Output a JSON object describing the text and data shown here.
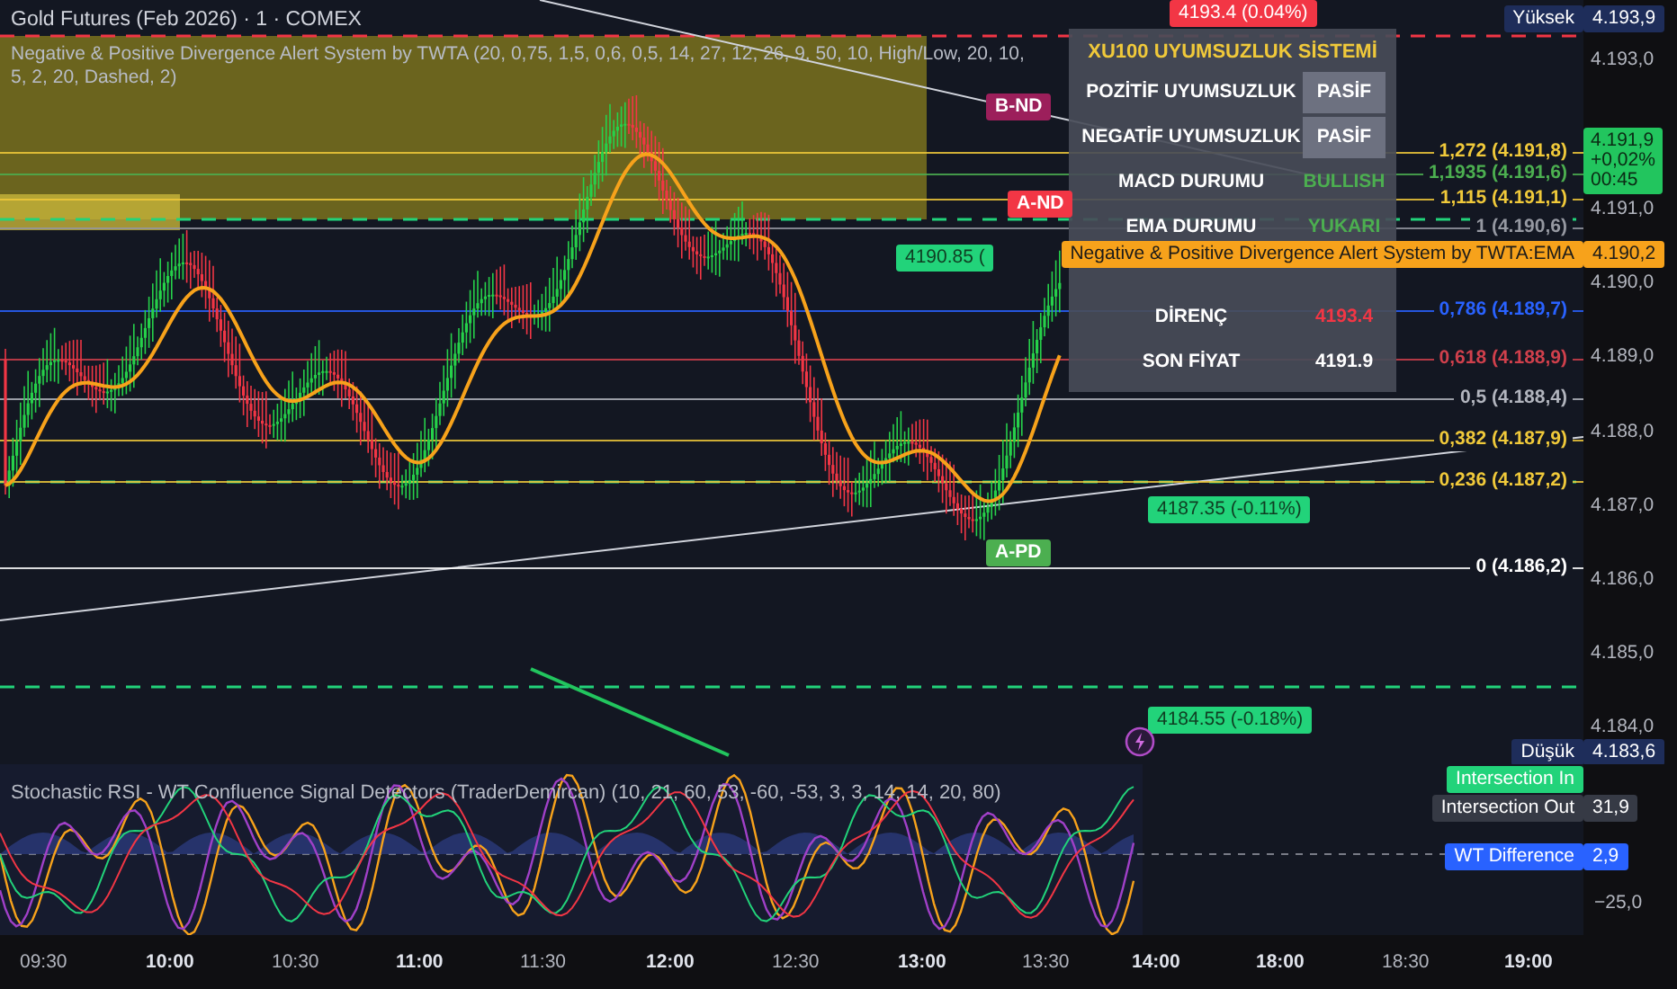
{
  "legend": {
    "symbol": "Gold Futures (Feb 2026) · 1 · COMEX",
    "indicator": "Negative & Positive Divergence Alert System by TWTA (20, 0,75, 1,5, 0,6, 0,5, 14, 27, 12, 26, 9, 50, 10, High/Low, 20, 10, 5, 2, 20, Dashed, 2)"
  },
  "table": {
    "title": "XU100 UYUMSUZLUK SİSTEMİ",
    "rows": [
      {
        "label": "POZİTİF UYUMSUZLUK",
        "value": "PASİF",
        "kind": "badge"
      },
      {
        "label": "NEGATİF UYUMSUZLUK",
        "value": "PASİF",
        "kind": "badge"
      },
      {
        "label": "MACD DURUMU",
        "value": "BULLISH",
        "kind": "text",
        "color": "#4caf50"
      },
      {
        "label": "EMA DURUMU",
        "value": "YUKARI",
        "kind": "text",
        "color": "#4caf50"
      },
      {
        "label": "DİRENÇ",
        "value": "4193.4",
        "kind": "text",
        "color": "#f23645"
      },
      {
        "label": "SON FİYAT",
        "value": "4191.9",
        "kind": "text",
        "color": "#ffffff"
      }
    ]
  },
  "fib_levels": [
    {
      "label": "1,272 (4.191,8)",
      "color": "#f0c93a"
    },
    {
      "label": "1,1935 (4.191,6)",
      "color": "#4caf50"
    },
    {
      "label": "1,115 (4.191,1)",
      "color": "#f0c93a"
    },
    {
      "label": "1 (4.190,6)",
      "color": "#9598a1"
    },
    {
      "label": "0,786 (4.189,7)",
      "color": "#2962ff"
    },
    {
      "label": "0,618 (4.188,9)",
      "color": "#d0404c"
    },
    {
      "label": "0,5 (4.188,4)",
      "color": "#b2b5be"
    },
    {
      "label": "0,382 (4.187,9)",
      "color": "#f0c93a"
    },
    {
      "label": "0,236 (4.187,2)",
      "color": "#f0c93a"
    },
    {
      "label": "0 (4.186,2)",
      "color": "#ffffff"
    }
  ],
  "chart_tags": [
    {
      "kind": "price",
      "text": "4193.4 (0.04%)",
      "color": "#f23645"
    },
    {
      "kind": "signal",
      "text": "B-ND",
      "color": "#9c1f5b"
    },
    {
      "kind": "signal",
      "text": "A-ND",
      "color": "#f23645"
    },
    {
      "kind": "price",
      "text": "4190.85 (",
      "color": "#22d37a"
    },
    {
      "kind": "signal",
      "text": "A-PD",
      "color": "#4caf50"
    },
    {
      "kind": "price",
      "text": "4187.35 (-0.11%)",
      "color": "#22d37a"
    },
    {
      "kind": "price",
      "text": "4184.55 (-0.18%)",
      "color": "#22d37a"
    }
  ],
  "price_axis": {
    "ticks": [
      "4.193,0",
      "4.191,0",
      "4.190,0",
      "4.189,0",
      "4.188,0",
      "4.187,0",
      "4.186,0",
      "4.185,0",
      "4.184,0"
    ],
    "high": {
      "label": "Yüksek",
      "value": "4.193,9"
    },
    "low": {
      "label": "Düşük",
      "value": "4.183,6"
    },
    "last": {
      "price": "4.191,9",
      "change": "+0,02%",
      "countdown": "00:45"
    },
    "ema_tag": {
      "name": "Negative & Positive Divergence Alert System by TWTA:EMA",
      "value": "4.190,2"
    }
  },
  "oscillator": {
    "legend": "Stochastic RSI - WT Confluence Signal Detectors (TraderDemircan) (10, 21, 60, 53, -60, -53, 3, 3, 14, 14, 20, 80)",
    "tags": [
      {
        "label": "Intersection In",
        "color": "#22d37a"
      },
      {
        "label": "Intersection Out",
        "value": "31,9",
        "color": "#363a45"
      },
      {
        "label": "WT Difference",
        "value": "2,9",
        "color": "#2962ff"
      }
    ],
    "ticks": [
      "−25,0"
    ]
  },
  "time_axis": [
    {
      "label": "09:30",
      "bold": false
    },
    {
      "label": "10:00",
      "bold": true
    },
    {
      "label": "10:30",
      "bold": false
    },
    {
      "label": "11:00",
      "bold": true
    },
    {
      "label": "11:30",
      "bold": false
    },
    {
      "label": "12:00",
      "bold": true
    },
    {
      "label": "12:30",
      "bold": false
    },
    {
      "label": "13:00",
      "bold": true
    },
    {
      "label": "13:30",
      "bold": false
    },
    {
      "label": "14:00",
      "bold": true
    },
    {
      "label": "18:00",
      "bold": true
    },
    {
      "label": "18:30",
      "bold": false
    },
    {
      "label": "19:00",
      "bold": true
    }
  ]
}
